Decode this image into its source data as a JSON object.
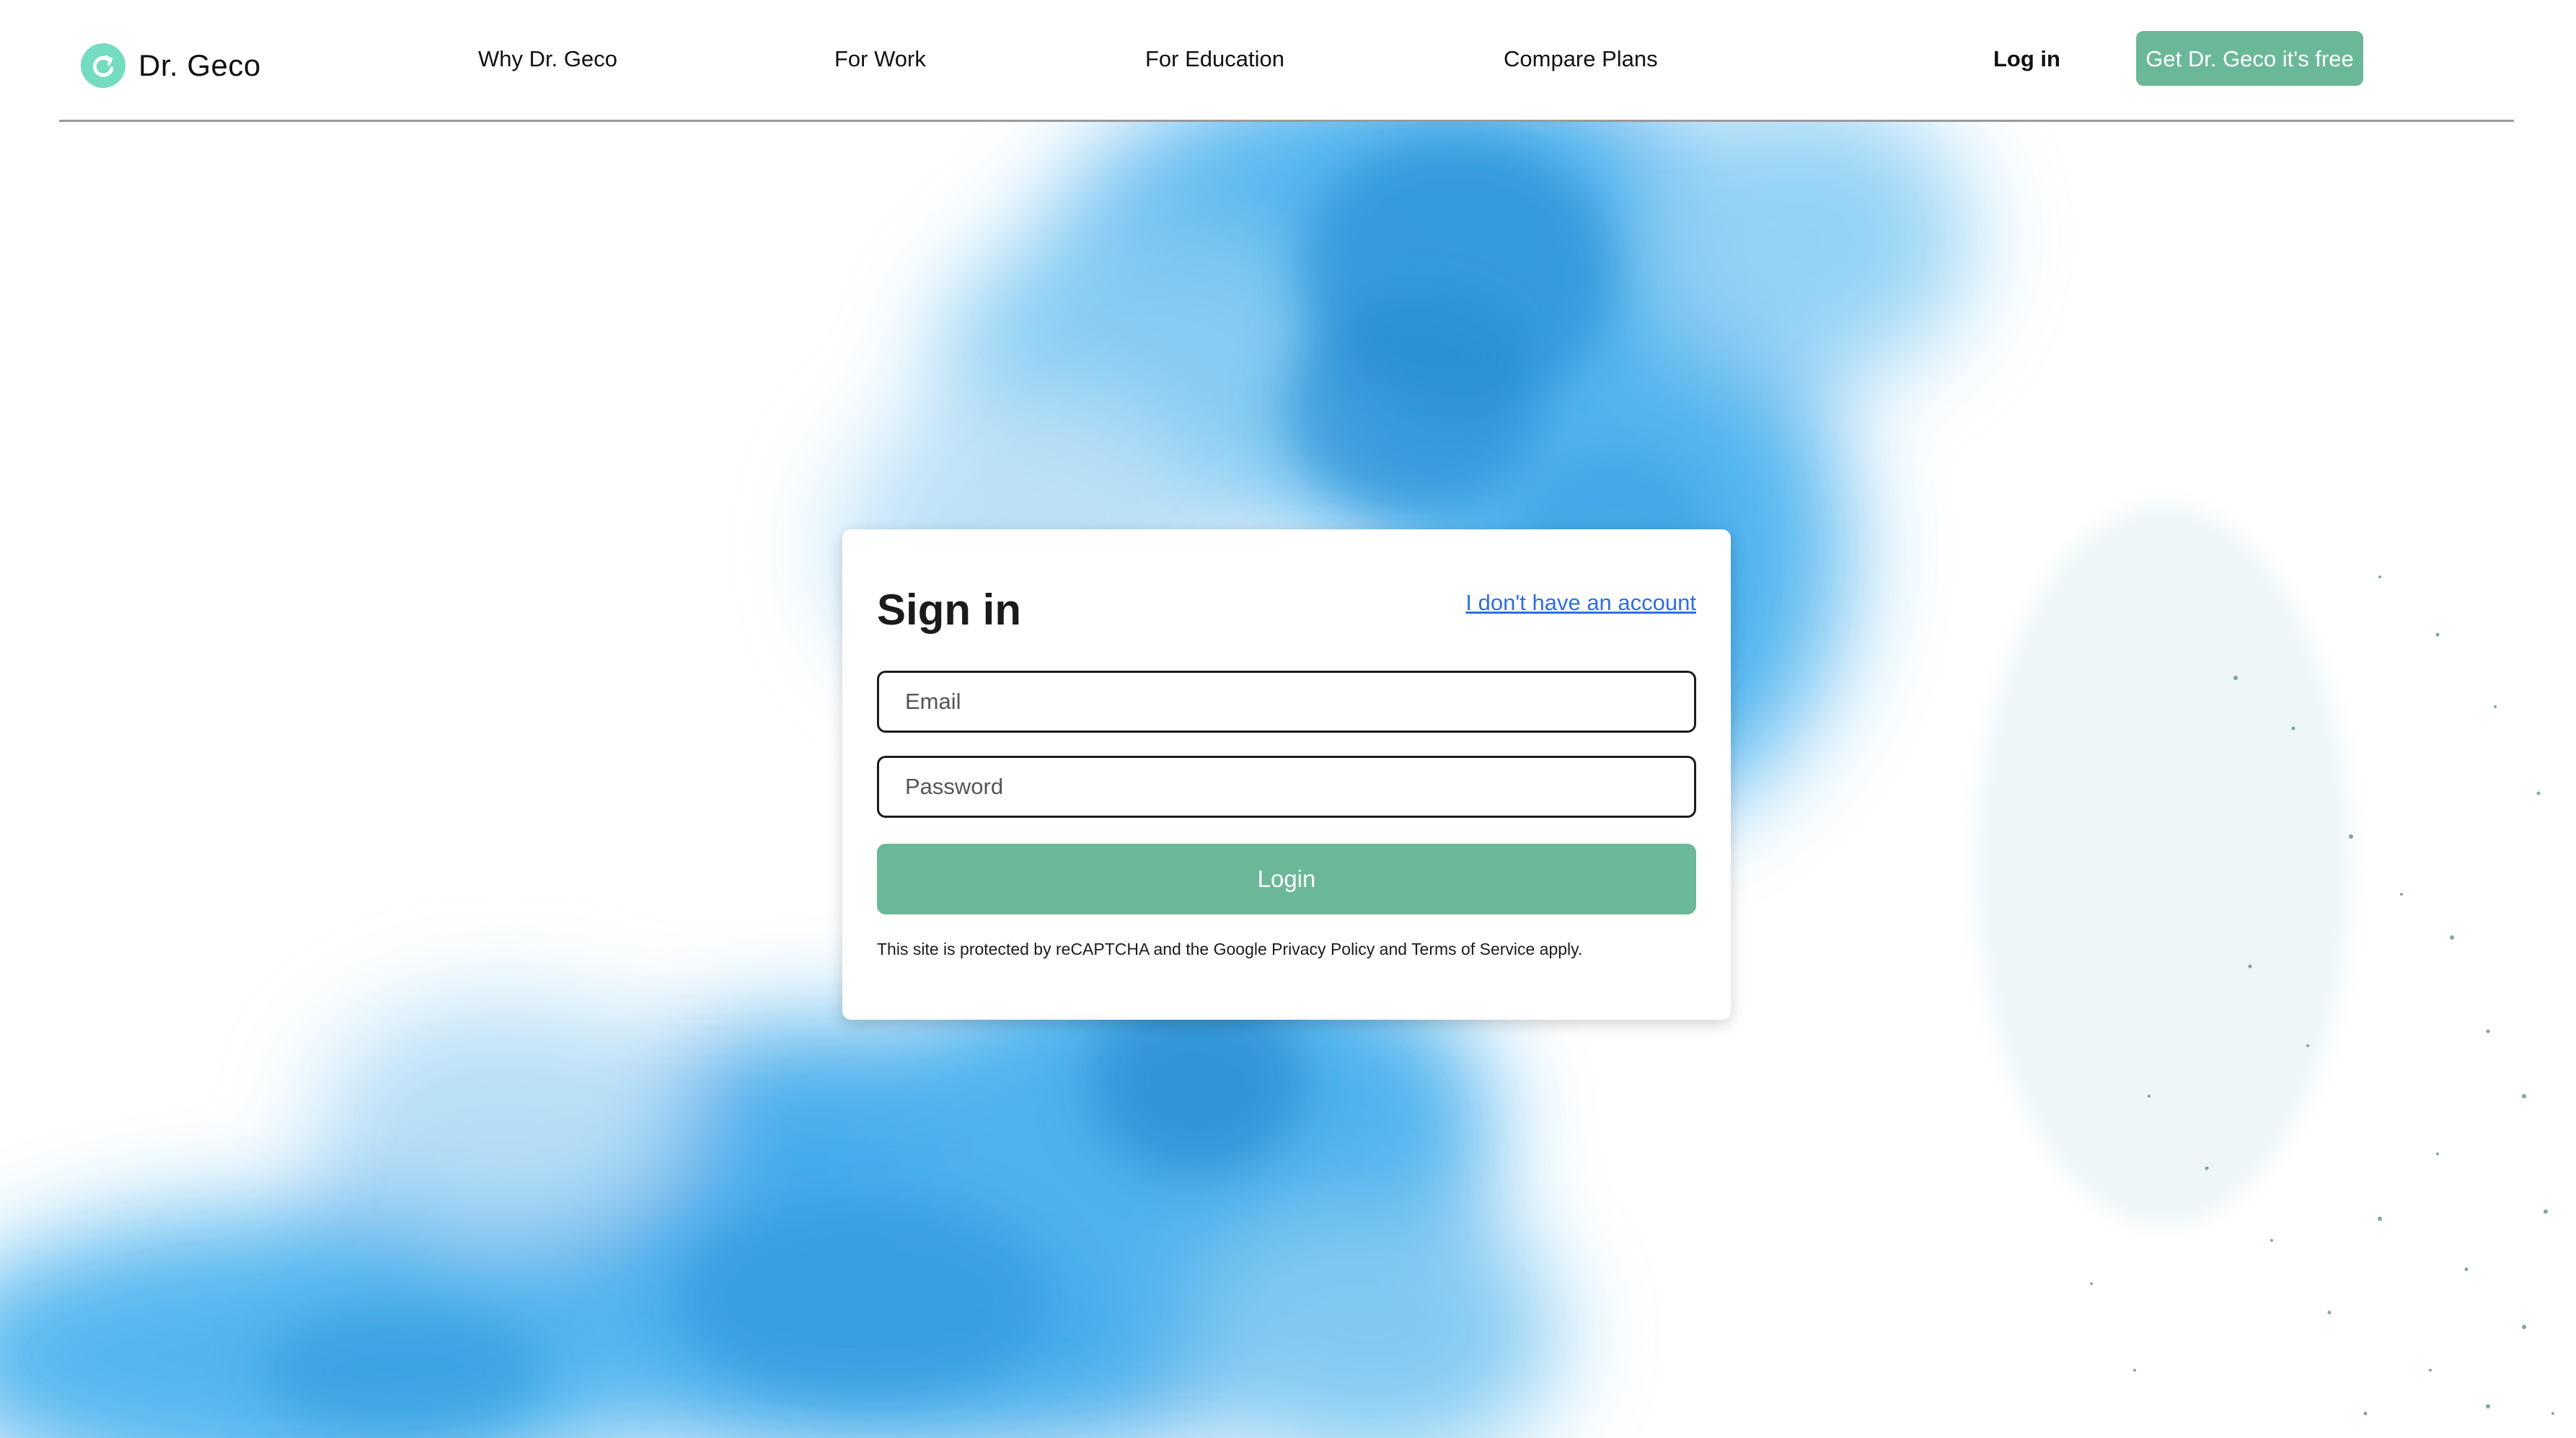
{
  "brand": {
    "name": "Dr. Geco",
    "logo_icon": "refresh-circle-icon",
    "accent_color": "#6bb899",
    "logo_color": "#74dcc0"
  },
  "nav": {
    "items": [
      {
        "label": "Why Dr. Geco"
      },
      {
        "label": "For Work"
      },
      {
        "label": "For Education"
      },
      {
        "label": "Compare Plans"
      }
    ],
    "login_label": "Log in",
    "cta_label": "Get Dr. Geco it's free"
  },
  "signin": {
    "title": "Sign in",
    "signup_link": "I don't have an account",
    "email_placeholder": "Email",
    "password_placeholder": "Password",
    "submit_label": "Login",
    "recaptcha_note": "This site is protected by reCAPTCHA and the Google Privacy Policy and Terms of Service apply.",
    "link_color": "#2f6fe0"
  },
  "background": {
    "ink_color": "#3aa7e8"
  }
}
